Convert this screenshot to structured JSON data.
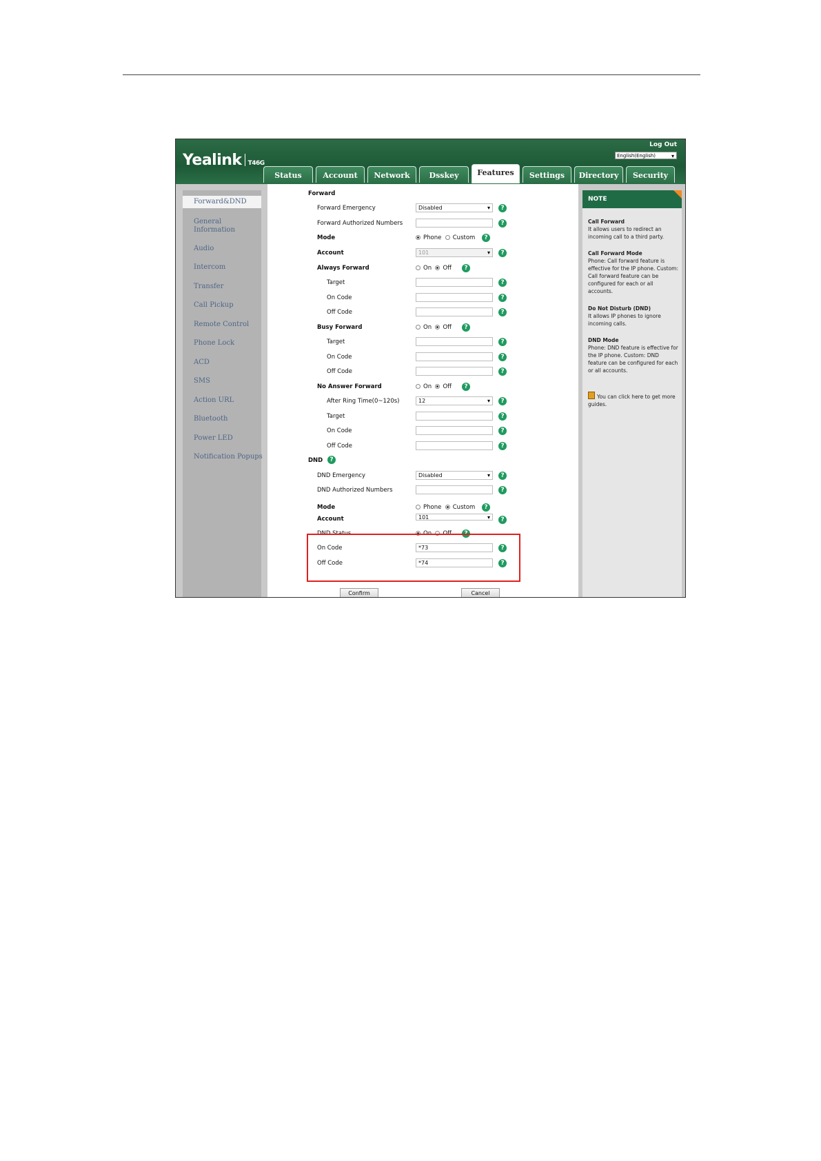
{
  "header": {
    "logo": "Yealink",
    "model": "T46G",
    "logout": "Log Out",
    "language": "English(English)"
  },
  "tabs": [
    {
      "label": "Status"
    },
    {
      "label": "Account"
    },
    {
      "label": "Network"
    },
    {
      "label": "Dsskey"
    },
    {
      "label": "Features",
      "active": true
    },
    {
      "label": "Settings"
    },
    {
      "label": "Directory"
    },
    {
      "label": "Security"
    }
  ],
  "sidebar": {
    "items": [
      {
        "label": "Forward&DND",
        "active": true
      },
      {
        "label": "General Information"
      },
      {
        "label": "Audio"
      },
      {
        "label": "Intercom"
      },
      {
        "label": "Transfer"
      },
      {
        "label": "Call Pickup"
      },
      {
        "label": "Remote Control"
      },
      {
        "label": "Phone Lock"
      },
      {
        "label": "ACD"
      },
      {
        "label": "SMS"
      },
      {
        "label": "Action URL"
      },
      {
        "label": "Bluetooth"
      },
      {
        "label": "Power LED"
      },
      {
        "label": "Notification Popups"
      }
    ]
  },
  "forward": {
    "section_title": "Forward",
    "emergency_label": "Forward Emergency",
    "emergency_value": "Disabled",
    "authorized_label": "Forward Authorized Numbers",
    "authorized_value": "",
    "mode_label": "Mode",
    "mode_phone": "Phone",
    "mode_custom": "Custom",
    "mode_selected": "Phone",
    "account_label": "Account",
    "account_value": "101",
    "always_label": "Always Forward",
    "busy_label": "Busy Forward",
    "noanswer_label": "No Answer Forward",
    "on": "On",
    "off": "Off",
    "target_label": "Target",
    "on_code_label": "On Code",
    "off_code_label": "Off Code",
    "ring_time_label": "After Ring Time(0~120s)",
    "ring_time_value": "12"
  },
  "dnd": {
    "section_title": "DND",
    "emergency_label": "DND Emergency",
    "emergency_value": "Disabled",
    "authorized_label": "DND Authorized Numbers",
    "authorized_value": "",
    "mode_label": "Mode",
    "mode_phone": "Phone",
    "mode_custom": "Custom",
    "mode_selected": "Custom",
    "account_label": "Account",
    "account_value": "101",
    "status_label": "DND Status",
    "status_on": "On",
    "status_off": "Off",
    "status_selected": "On",
    "on_code_label": "On Code",
    "on_code_value": "*73",
    "off_code_label": "Off Code",
    "off_code_value": "*74"
  },
  "buttons": {
    "confirm": "Confirm",
    "cancel": "Cancel"
  },
  "note": {
    "title": "NOTE",
    "sections": [
      {
        "heading": "Call Forward",
        "text": "It allows users to redirect an incoming call to a third party."
      },
      {
        "heading": "Call Forward Mode",
        "text": "Phone: Call forward feature is effective for the IP phone. Custom: Call forward feature can be configured for each or all accounts."
      },
      {
        "heading": "Do Not Disturb (DND)",
        "text": "It allows IP phones to ignore incoming calls."
      },
      {
        "heading": "DND Mode",
        "text": "Phone: DND feature is effective for the IP phone. Custom: DND feature can be configured for each or all accounts."
      }
    ],
    "guide_text": "You can click here to get more guides."
  },
  "colors": {
    "brand_green": "#1f6b45",
    "help_green": "#1f9b5f",
    "highlight_red": "#e0201e",
    "note_corner": "#f08a24"
  }
}
